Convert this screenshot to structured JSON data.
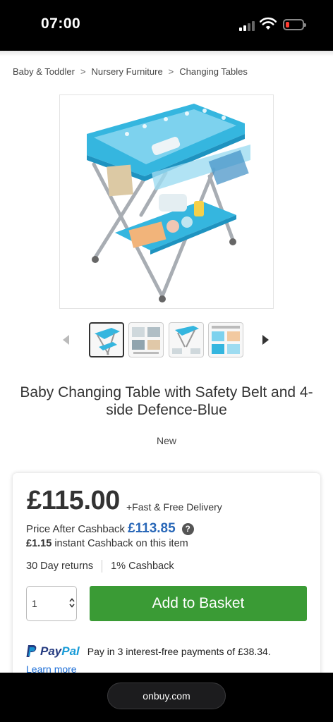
{
  "status_bar": {
    "time": "07:00"
  },
  "breadcrumb": [
    "Baby & Toddler",
    "Nursery Furniture",
    "Changing Tables"
  ],
  "breadcrumb_separator": ">",
  "product": {
    "title": "Baby Changing Table with Safety Belt and 4-side Defence-Blue",
    "condition": "New",
    "thumbnails": [
      "thumb-1",
      "thumb-2",
      "thumb-3",
      "thumb-4"
    ],
    "selected_thumbnail": 1
  },
  "buy_box": {
    "price": "£115.00",
    "delivery": "+Fast & Free Delivery",
    "cashback_label": "Price After Cashback",
    "cashback_price": "£113.85",
    "help": "?",
    "instant_cashback_amount": "£1.15",
    "instant_cashback_text": "instant Cashback on this item",
    "returns": "30 Day returns",
    "cashback_percent": "1% Cashback",
    "quantity": "1",
    "add_to_basket": "Add to Basket",
    "paypal_pay": "Pay",
    "paypal_pal": "Pal",
    "paypal_text": "Pay in 3 interest-free payments of £38.34.",
    "learn_more": "Learn more"
  },
  "browser": {
    "url": "onbuy.com"
  },
  "colors": {
    "accent_green": "#3a9b35",
    "cashback_blue": "#2a68b8",
    "paypal_dark": "#253b80",
    "paypal_light": "#179bd7",
    "product_blue": "#35b6df"
  }
}
